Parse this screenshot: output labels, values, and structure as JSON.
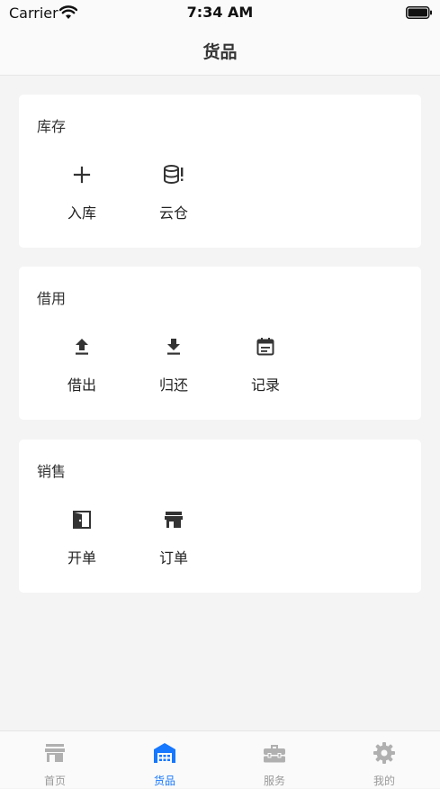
{
  "status_bar": {
    "carrier": "Carrier",
    "time": "7:34 AM"
  },
  "nav": {
    "title": "货品"
  },
  "sections": [
    {
      "title": "库存",
      "items": [
        {
          "label": "入库",
          "icon": "plus-icon"
        },
        {
          "label": "云仓",
          "icon": "database-alert-icon"
        }
      ]
    },
    {
      "title": "借用",
      "items": [
        {
          "label": "借出",
          "icon": "upload-icon"
        },
        {
          "label": "归还",
          "icon": "download-icon"
        },
        {
          "label": "记录",
          "icon": "calendar-icon"
        }
      ]
    },
    {
      "title": "销售",
      "items": [
        {
          "label": "开单",
          "icon": "door-icon"
        },
        {
          "label": "订单",
          "icon": "store-icon"
        }
      ]
    }
  ],
  "tabs": [
    {
      "label": "首页",
      "icon": "storefront-icon",
      "active": false
    },
    {
      "label": "货品",
      "icon": "warehouse-icon",
      "active": true
    },
    {
      "label": "服务",
      "icon": "toolbox-icon",
      "active": false
    },
    {
      "label": "我的",
      "icon": "gear-icon",
      "active": false
    }
  ],
  "colors": {
    "active": "#1677ff",
    "inactive": "#b0b0b0",
    "icon": "#333333"
  }
}
